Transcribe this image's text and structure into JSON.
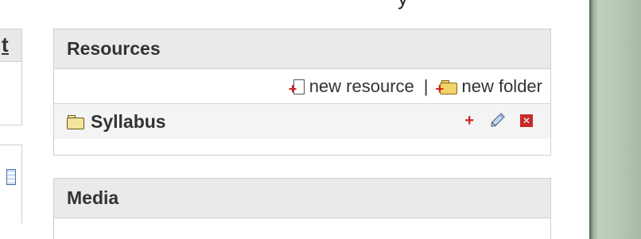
{
  "top_clipped_text": "y",
  "left_column": {
    "header_fragment": "t"
  },
  "resources_panel": {
    "title": "Resources",
    "actions": {
      "new_resource_label": "new resource",
      "separator": "|",
      "new_folder_label": "new folder"
    },
    "items": [
      {
        "label": "Syllabus",
        "icon": "folder-icon"
      }
    ]
  },
  "media_panel": {
    "title": "Media"
  },
  "colors": {
    "add_red": "#d12020",
    "delete_red": "#c92a2a",
    "header_gray": "#eaeaea",
    "side_green": "#b7c6b3"
  }
}
